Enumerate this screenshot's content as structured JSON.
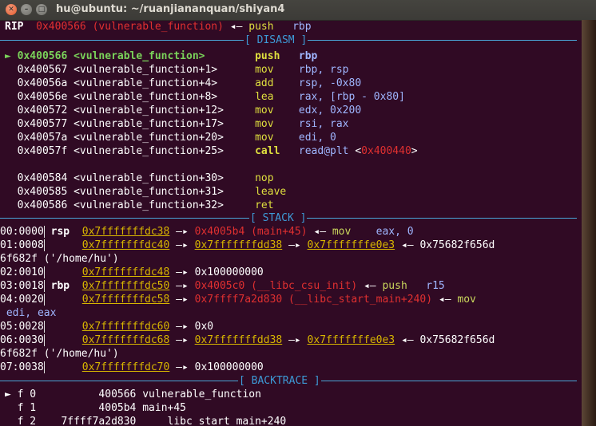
{
  "window": {
    "title": "hu@ubuntu: ~/ruanjiananquan/shiyan4",
    "close_glyph": "✕",
    "min_glyph": "–",
    "max_glyph": "□"
  },
  "rip": {
    "label": "RIP",
    "addr": "0x400566 (vulnerable_function)",
    "arrow": "◂—",
    "mnem": "push",
    "op": "rbp"
  },
  "sections": {
    "disasm": "[ DISASM ]",
    "stack": "[ STACK ]",
    "backtrace": "[ BACKTRACE ]"
  },
  "disasm": [
    {
      "marker": "►",
      "addr": "0x400566",
      "sym": "<vulnerable_function>",
      "mnem": "push",
      "ops": "rbp",
      "current": true
    },
    {
      "marker": "",
      "addr": "0x400567",
      "sym": "<vulnerable_function+1>",
      "mnem": "mov",
      "ops": "rbp, rsp"
    },
    {
      "marker": "",
      "addr": "0x40056a",
      "sym": "<vulnerable_function+4>",
      "mnem": "add",
      "ops": "rsp, -0x80"
    },
    {
      "marker": "",
      "addr": "0x40056e",
      "sym": "<vulnerable_function+8>",
      "mnem": "lea",
      "ops": "rax, [rbp - 0x80]"
    },
    {
      "marker": "",
      "addr": "0x400572",
      "sym": "<vulnerable_function+12>",
      "mnem": "mov",
      "ops": "edx, 0x200"
    },
    {
      "marker": "",
      "addr": "0x400577",
      "sym": "<vulnerable_function+17>",
      "mnem": "mov",
      "ops": "rsi, rax"
    },
    {
      "marker": "",
      "addr": "0x40057a",
      "sym": "<vulnerable_function+20>",
      "mnem": "mov",
      "ops": "edi, 0"
    },
    {
      "marker": "",
      "addr": "0x40057f",
      "sym": "<vulnerable_function+25>",
      "mnem": "call",
      "ops": "read@plt",
      "target": "0x400440"
    },
    {
      "marker": "",
      "addr": "0x400584",
      "sym": "<vulnerable_function+30>",
      "mnem": "nop",
      "ops": ""
    },
    {
      "marker": "",
      "addr": "0x400585",
      "sym": "<vulnerable_function+31>",
      "mnem": "leave",
      "ops": ""
    },
    {
      "marker": "",
      "addr": "0x400586",
      "sym": "<vulnerable_function+32>",
      "mnem": "ret",
      "ops": ""
    }
  ],
  "stack": {
    "r0": {
      "off": "00:0000",
      "reg": "rsp",
      "a": "0x7fffffffdc38",
      "b": "0x4005b4 (main+45)",
      "m": "mov",
      "o": "eax, 0"
    },
    "r1": {
      "off": "01:0008",
      "a": "0x7fffffffdc40",
      "b": "0x7fffffffdd38",
      "c": "0x7fffffffe0e3",
      "d": "0x75682f656d"
    },
    "r1w": "6f682f ('/home/hu')",
    "r2": {
      "off": "02:0010",
      "a": "0x7fffffffdc48",
      "b": "0x100000000"
    },
    "r3": {
      "off": "03:0018",
      "reg": "rbp",
      "a": "0x7fffffffdc50",
      "b": "0x4005c0 (__libc_csu_init)",
      "m": "push",
      "o": "r15"
    },
    "r4": {
      "off": "04:0020",
      "a": "0x7fffffffdc58",
      "b": "0x7ffff7a2d830 (__libc_start_main+240)",
      "m": "mov"
    },
    "r4w": "edi, eax",
    "r5": {
      "off": "05:0028",
      "a": "0x7fffffffdc60",
      "b": "0x0"
    },
    "r6": {
      "off": "06:0030",
      "a": "0x7fffffffdc68",
      "b": "0x7fffffffdd38",
      "c": "0x7fffffffe0e3",
      "d": "0x75682f656d"
    },
    "r6w": "6f682f ('/home/hu')",
    "r7": {
      "off": "07:0038",
      "a": "0x7fffffffdc70",
      "b": "0x100000000"
    },
    "arrow": "—▸",
    "larrow": "◂—"
  },
  "backtrace": [
    {
      "marker": "►",
      "frame": "f 0",
      "addr": "400566",
      "sym": "vulnerable_function"
    },
    {
      "marker": "",
      "frame": "f 1",
      "addr": "4005b4",
      "sym": "main+45"
    },
    {
      "marker": "",
      "frame": "f 2",
      "addr": "7ffff7a2d830",
      "sym": "__libc_start_main+240"
    }
  ]
}
